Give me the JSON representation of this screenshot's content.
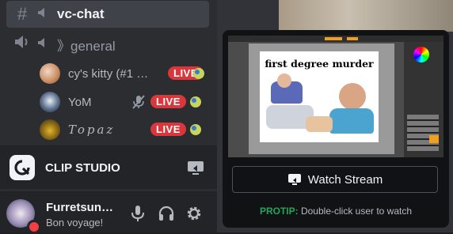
{
  "channels": [
    {
      "name": "vc-chat",
      "state": "active"
    },
    {
      "name": "》general",
      "state": "voice"
    }
  ],
  "voice_users": [
    {
      "name": "cy's kitty (#1 H…",
      "live": "LIVE"
    },
    {
      "name": "YoM",
      "live": "LIVE",
      "muted": true
    },
    {
      "name": "𝓣𝓸𝓹𝓪𝔃",
      "display": "Topaz",
      "live": "LIVE"
    }
  ],
  "activity": {
    "app_name": "CLIP STUDIO"
  },
  "user_panel": {
    "username": "Furretsun…",
    "status": "Bon voyage!"
  },
  "stream_preview": {
    "meme_caption": "first degree murder",
    "watch_button": "Watch Stream",
    "protip_label": "PROTIP:",
    "protip_text": "Double-click user to watch"
  },
  "colors": {
    "live_badge": "#da373c",
    "protip": "#23a55a",
    "active_channel_bg": "#404249"
  }
}
